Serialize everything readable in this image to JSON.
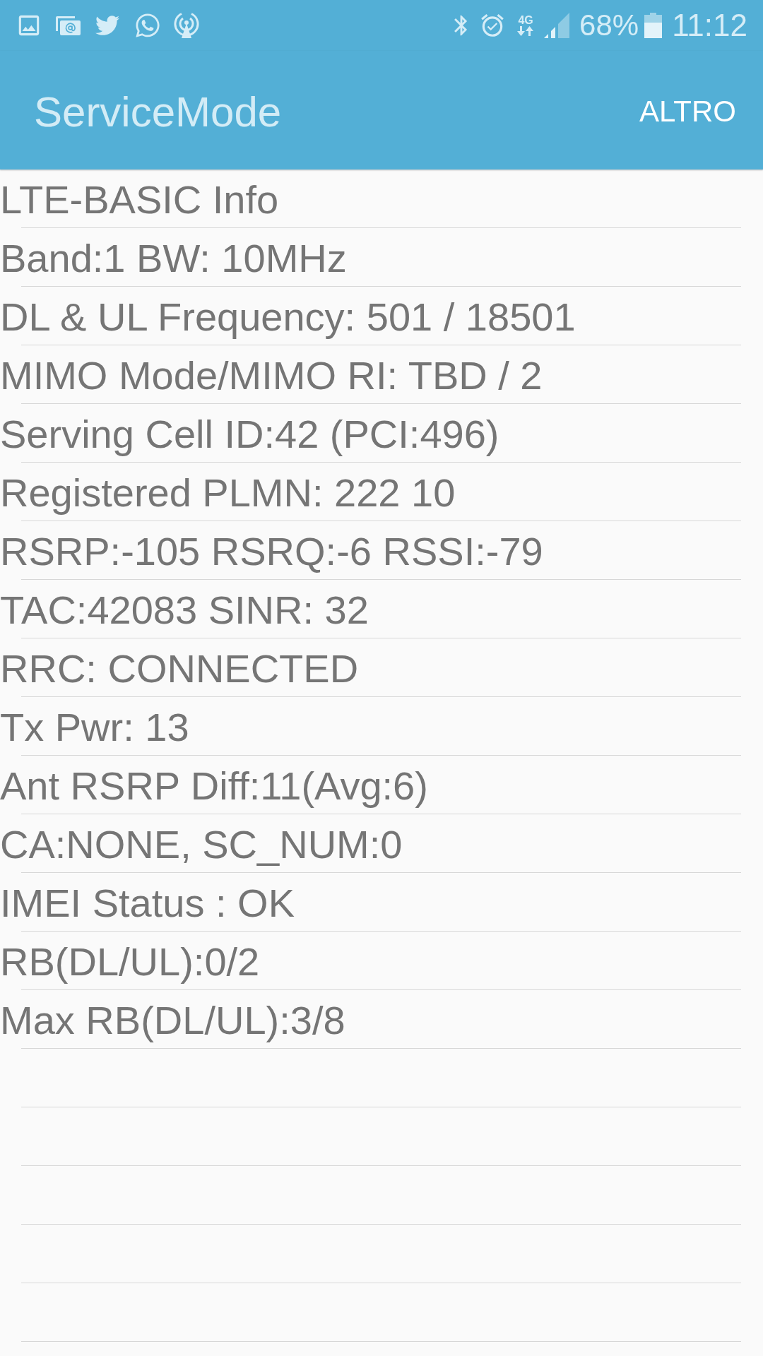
{
  "status_bar": {
    "network_type": "4G",
    "battery": "68%",
    "time": "11:12"
  },
  "app_bar": {
    "title": "ServiceMode",
    "menu": "ALTRO"
  },
  "info_lines": [
    "LTE-BASIC Info",
    "Band:1 BW: 10MHz",
    "DL & UL Frequency: 501 / 18501",
    "MIMO Mode/MIMO RI: TBD / 2",
    "Serving Cell ID:42 (PCI:496)",
    "Registered PLMN: 222 10",
    "RSRP:-105 RSRQ:-6 RSSI:-79",
    "TAC:42083 SINR: 32",
    "RRC: CONNECTED",
    "Tx Pwr: 13",
    "Ant RSRP Diff:11(Avg:6)",
    "CA:NONE, SC_NUM:0",
    "IMEI Status : OK",
    "RB(DL/UL):0/2",
    "Max RB(DL/UL):3/8"
  ]
}
